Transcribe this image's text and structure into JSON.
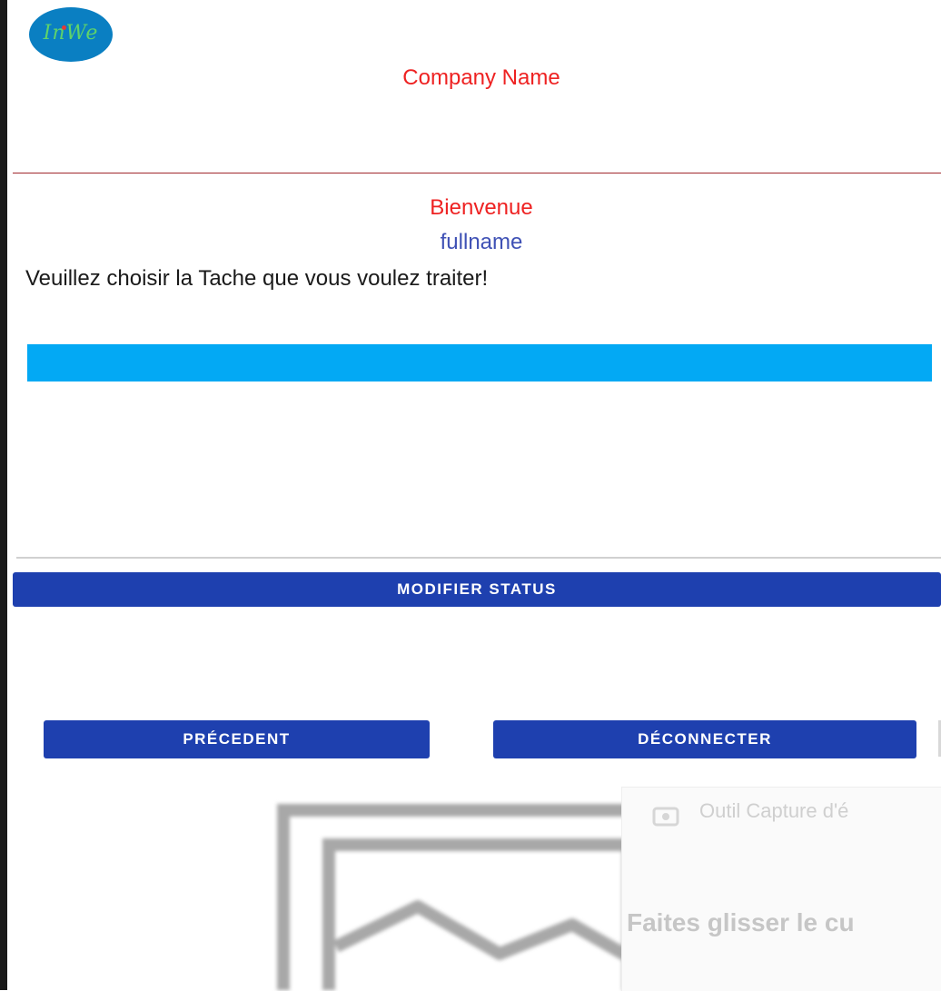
{
  "header": {
    "logo_text": "InWe",
    "company_name": "Company Name"
  },
  "main": {
    "welcome": "Bienvenue",
    "fullname": "fullname",
    "instruction": "Veuillez choisir la Tache que vous voulez traiter!"
  },
  "actions": {
    "modify_status": "MODIFIER STATUS",
    "previous": "PRÉCEDENT",
    "logout": "DÉCONNECTER"
  },
  "overlay": {
    "title": "Outil Capture d'é",
    "hint": "Faites glisser le cu"
  },
  "colors": {
    "accent_red": "#ee2222",
    "button_blue": "#1e40af",
    "task_bar": "#03a9f4",
    "fullname": "#3f51b5"
  },
  "icons": {
    "logo": "inwe-logo",
    "image_placeholder": "image-placeholder-icon",
    "capture_tool": "capture-tool-icon"
  }
}
